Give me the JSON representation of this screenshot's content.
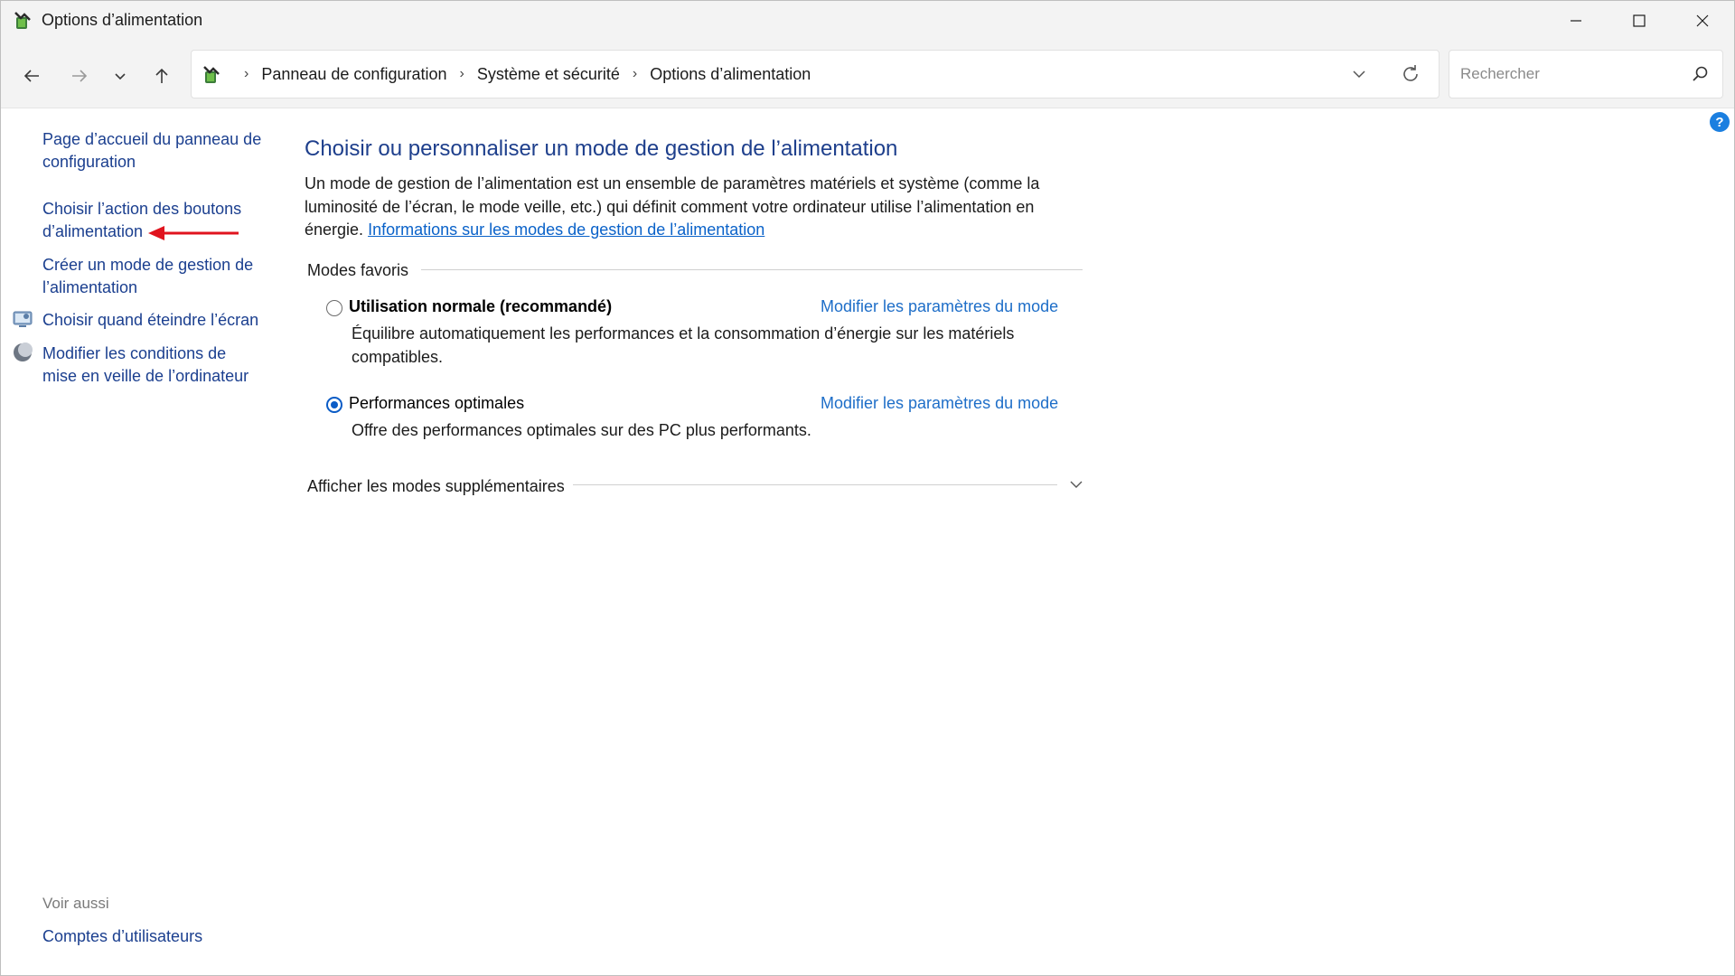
{
  "window": {
    "title": "Options d’alimentation",
    "icons": {
      "app": "power-options-icon",
      "minimize": "minimize-icon",
      "maximize": "maximize-icon",
      "close": "close-icon"
    }
  },
  "nav": {
    "back_icon": "arrow-left-icon",
    "forward_icon": "arrow-right-icon",
    "recent_icon": "chevron-down-icon",
    "up_icon": "arrow-up-icon",
    "breadcrumbs": [
      "Panneau de configuration",
      "Système et sécurité",
      "Options d’alimentation"
    ],
    "search_placeholder": "Rechercher"
  },
  "help": {
    "label": "?"
  },
  "sidebar": {
    "items": [
      {
        "label": "Page d’accueil du panneau de configuration"
      },
      {
        "label": "Choisir l’action des boutons d’alimentation"
      },
      {
        "label": "Créer un mode de gestion de l’alimentation"
      },
      {
        "label": "Choisir quand éteindre l’écran",
        "icon": "display-icon"
      },
      {
        "label": "Modifier les conditions de mise en veille de l’ordinateur",
        "icon": "sleep-moon-icon"
      }
    ],
    "see_also": "Voir aussi",
    "see_also_links": [
      {
        "label": "Comptes d’utilisateurs"
      }
    ]
  },
  "main": {
    "title": "Choisir ou personnaliser un mode de gestion de l’alimentation",
    "description": "Un mode de gestion de l’alimentation est un ensemble de paramètres matériels et système (comme la luminosité de l’écran, le mode veille, etc.) qui définit comment votre ordinateur utilise l’alimentation en énergie.",
    "info_link": "Informations sur les modes de gestion de l’alimentation",
    "favorites_label": "Modes favoris",
    "plans": [
      {
        "name": "Utilisation normale (recommandé)",
        "selected": false,
        "description": "Équilibre automatiquement les performances et la consommation d’énergie sur les matériels compatibles.",
        "link": "Modifier les paramètres du mode"
      },
      {
        "name": "Performances optimales",
        "selected": true,
        "description": "Offre des performances optimales sur des PC plus performants.",
        "link": "Modifier les paramètres du mode"
      }
    ],
    "more_plans_label": "Afficher les modes supplémentaires"
  },
  "colors": {
    "link": "#1b3f8f",
    "title": "#1e3f8c",
    "accent": "#0b5cc6",
    "annotation_arrow": "#e0141e"
  }
}
